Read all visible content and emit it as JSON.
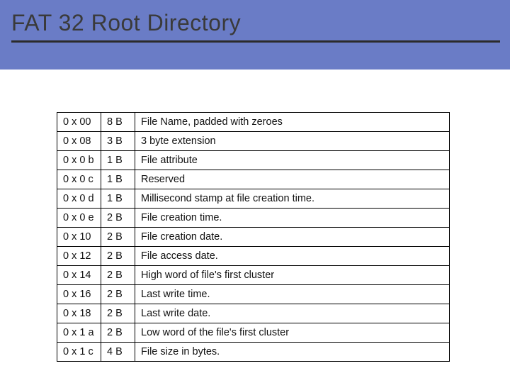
{
  "title": "FAT 32 Root Directory",
  "rows": [
    {
      "offset": "0 x 00",
      "size": "8 B",
      "desc": "File Name, padded with zeroes"
    },
    {
      "offset": "0 x 08",
      "size": "3 B",
      "desc": "3 byte extension"
    },
    {
      "offset": "0 x 0 b",
      "size": "1 B",
      "desc": "File attribute"
    },
    {
      "offset": "0 x 0 c",
      "size": "1 B",
      "desc": "Reserved"
    },
    {
      "offset": "0 x 0 d",
      "size": "1 B",
      "desc": "Millisecond stamp at file creation time."
    },
    {
      "offset": "0 x 0 e",
      "size": "2 B",
      "desc": "File creation time."
    },
    {
      "offset": "0 x 10",
      "size": "2 B",
      "desc": "File creation date."
    },
    {
      "offset": "0 x 12",
      "size": "2 B",
      "desc": "File access date."
    },
    {
      "offset": "0 x 14",
      "size": "2 B",
      "desc": "High word of file's first cluster"
    },
    {
      "offset": "0 x 16",
      "size": "2 B",
      "desc": "Last write time."
    },
    {
      "offset": "0 x 18",
      "size": "2 B",
      "desc": "Last write date."
    },
    {
      "offset": "0 x 1 a",
      "size": "2 B",
      "desc": "Low word of the file's first cluster"
    },
    {
      "offset": "0 x 1 c",
      "size": "4 B",
      "desc": "File size in bytes."
    }
  ]
}
